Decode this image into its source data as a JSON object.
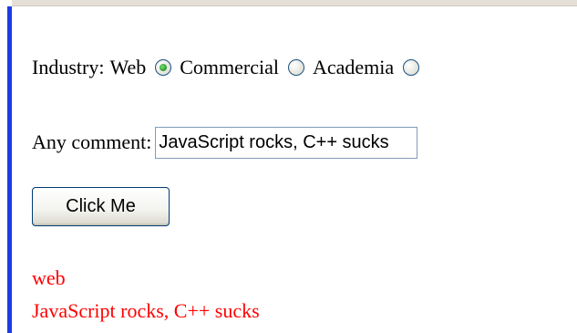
{
  "form": {
    "industry_label": "Industry:",
    "options": [
      {
        "label": "Web",
        "checked": true
      },
      {
        "label": "Commercial",
        "checked": false
      },
      {
        "label": "Academia",
        "checked": false
      }
    ],
    "comment_label": "Any comment:",
    "comment_value": "JavaScript rocks, C++ sucks",
    "button_label": "Click Me"
  },
  "output": {
    "line1": "web",
    "line2": "JavaScript rocks, C++ sucks"
  },
  "colors": {
    "accent_border": "#1c3ce6",
    "output_text": "#ff0000"
  }
}
